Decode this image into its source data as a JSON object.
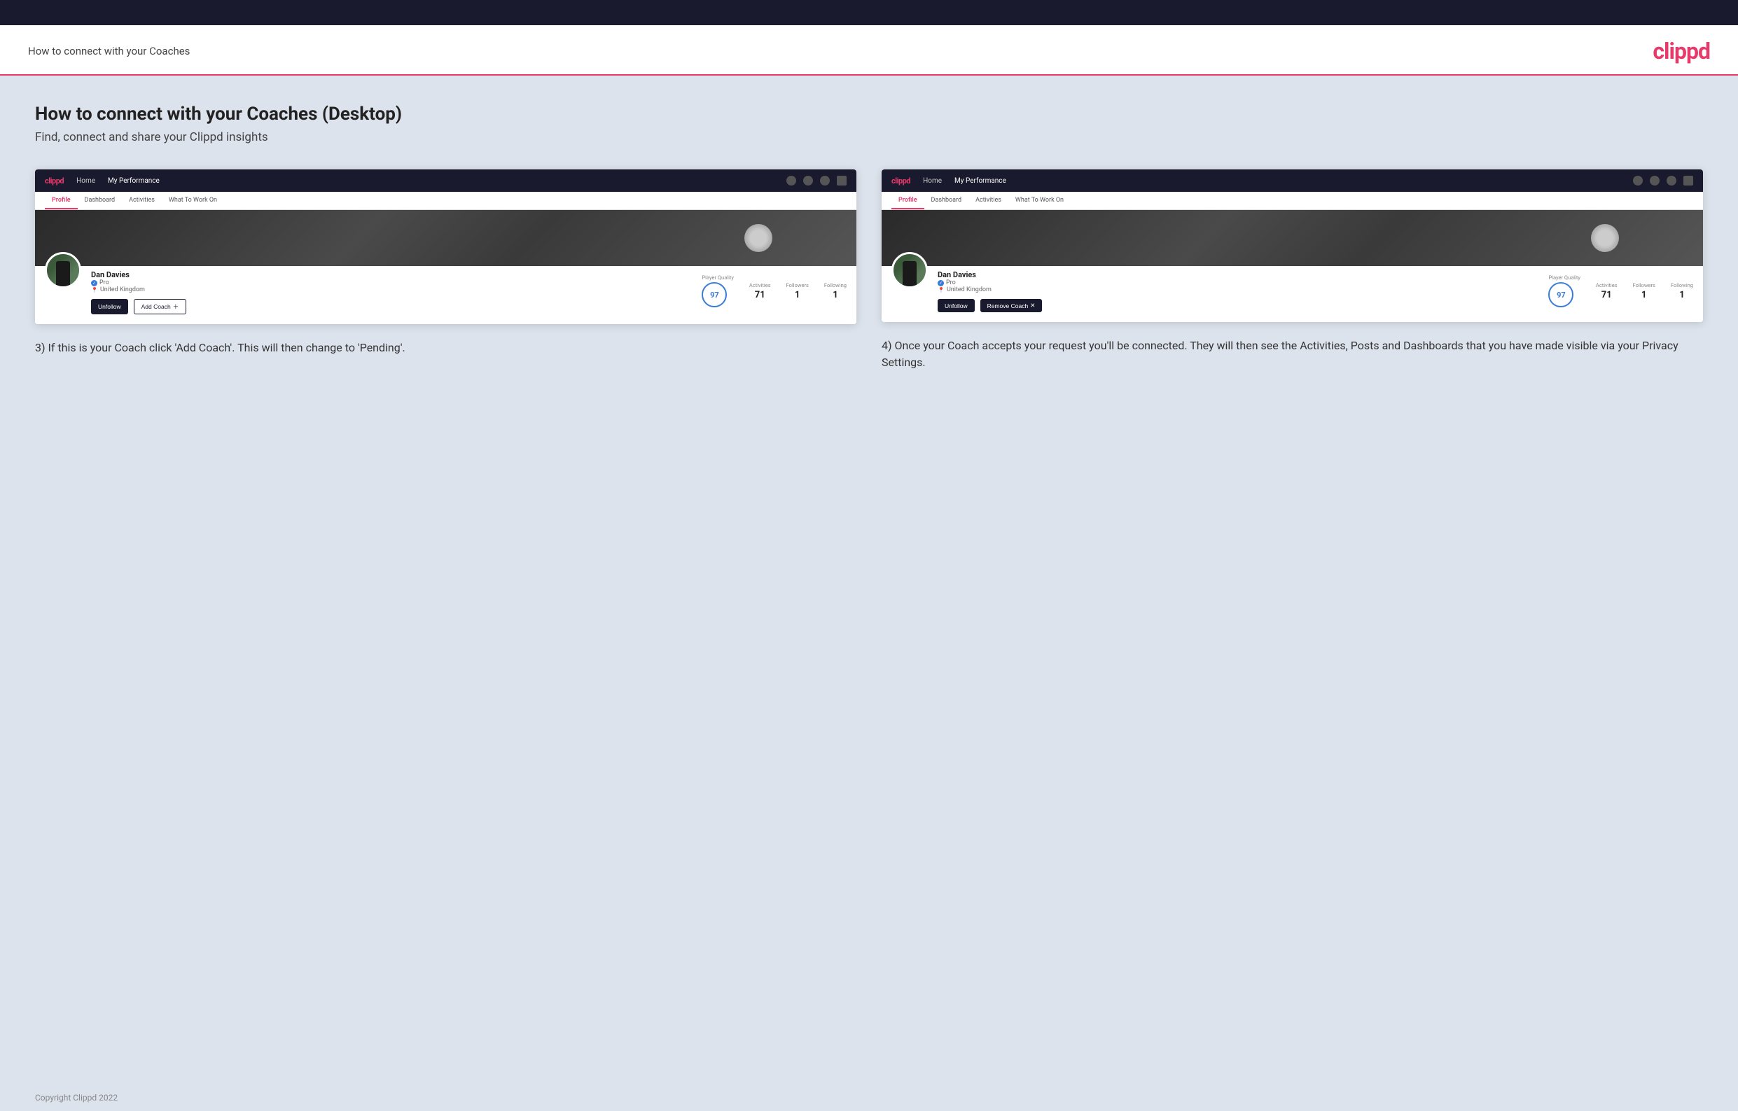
{
  "topbar": {},
  "header": {
    "title": "How to connect with your Coaches",
    "logo": "clippd"
  },
  "main": {
    "heading": "How to connect with your Coaches (Desktop)",
    "subheading": "Find, connect and share your Clippd insights",
    "screenshot_left": {
      "nav": {
        "logo": "clippd",
        "links": [
          "Home",
          "My Performance"
        ],
        "active_link": "My Performance"
      },
      "tabs": [
        "Profile",
        "Dashboard",
        "Activities",
        "What To Work On"
      ],
      "active_tab": "Profile",
      "user": {
        "name": "Dan Davies",
        "tag": "Pro",
        "location": "United Kingdom",
        "player_quality": "97",
        "activities": "71",
        "followers": "1",
        "following": "1"
      },
      "buttons": [
        "Unfollow",
        "Add Coach"
      ]
    },
    "screenshot_right": {
      "nav": {
        "logo": "clippd",
        "links": [
          "Home",
          "My Performance"
        ],
        "active_link": "My Performance"
      },
      "tabs": [
        "Profile",
        "Dashboard",
        "Activities",
        "What To Work On"
      ],
      "active_tab": "Profile",
      "user": {
        "name": "Dan Davies",
        "tag": "Pro",
        "location": "United Kingdom",
        "player_quality": "97",
        "activities": "71",
        "followers": "1",
        "following": "1"
      },
      "buttons": [
        "Unfollow",
        "Remove Coach"
      ]
    },
    "desc_left": "3) If this is your Coach click 'Add Coach'. This will then change to 'Pending'.",
    "desc_right": "4) Once your Coach accepts your request you'll be connected. They will then see the Activities, Posts and Dashboards that you have made visible via your Privacy Settings.",
    "footer": "Copyright Clippd 2022"
  }
}
